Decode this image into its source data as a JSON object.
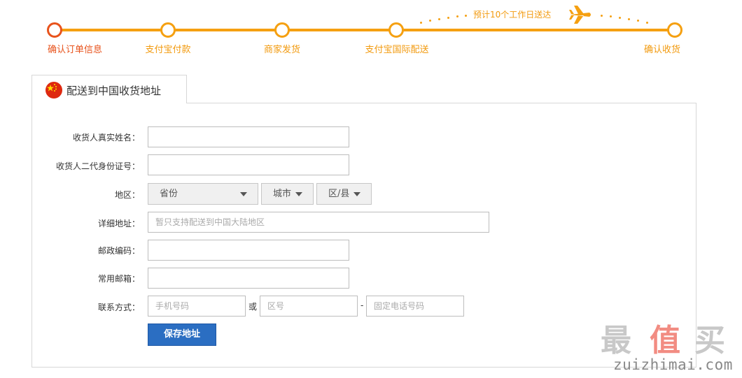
{
  "progress": {
    "steps": [
      {
        "label": "确认订单信息",
        "active": true
      },
      {
        "label": "支付宝付款",
        "active": false
      },
      {
        "label": "商家发货",
        "active": false
      },
      {
        "label": "支付宝国际配送",
        "active": false
      },
      {
        "label": "确认收货",
        "active": false
      }
    ],
    "eta": "预计10个工作日送达",
    "accent": "#f5a011",
    "active_color": "#e8531c"
  },
  "tab": {
    "title": "配送到中国收货地址",
    "icon": "china-flag-icon"
  },
  "form": {
    "name_label": "收货人真实姓名：",
    "name_value": "",
    "id_label": "收货人二代身份证号：",
    "id_value": "",
    "region_label": "地区：",
    "province": "省份",
    "city": "城市",
    "district": "区/县",
    "address_label": "详细地址：",
    "address_placeholder": "暂只支持配送到中国大陆地区",
    "postcode_label": "邮政编码：",
    "postcode_value": "",
    "email_label": "常用邮箱：",
    "email_value": "",
    "contact_label": "联系方式：",
    "mobile_placeholder": "手机号码",
    "or_text": "或",
    "area_code_placeholder": "区号",
    "dash_text": "-",
    "landline_placeholder": "固定电话号码",
    "save_label": "保存地址"
  },
  "watermark": {
    "chars": [
      "最",
      "值",
      "买"
    ],
    "url": "zuizhimai.com",
    "colors": [
      "#c8c8c8",
      "#f28c82",
      "#c8c8c8"
    ]
  },
  "colors": {
    "button": "#2b6ec2",
    "border": "#d7d7d7"
  }
}
